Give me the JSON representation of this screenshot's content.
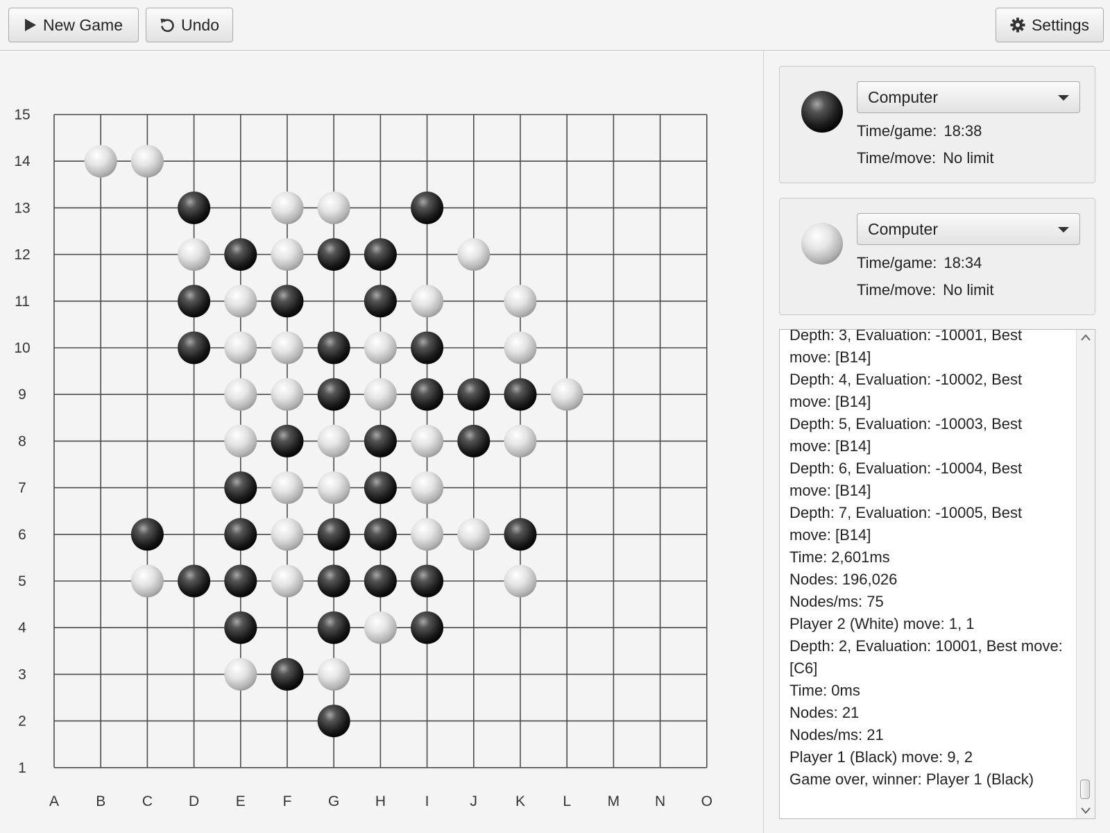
{
  "toolbar": {
    "new_game_label": "New Game",
    "undo_label": "Undo",
    "settings_label": "Settings"
  },
  "board": {
    "columns": [
      "A",
      "B",
      "C",
      "D",
      "E",
      "F",
      "G",
      "H",
      "I",
      "J",
      "K",
      "L",
      "M",
      "N",
      "O"
    ],
    "rows": [
      "15",
      "14",
      "13",
      "12",
      "11",
      "10",
      "9",
      "8",
      "7",
      "6",
      "5",
      "4",
      "3",
      "2",
      "1"
    ],
    "stones": [
      {
        "pos": "B14",
        "color": "white"
      },
      {
        "pos": "C14",
        "color": "white"
      },
      {
        "pos": "D13",
        "color": "black"
      },
      {
        "pos": "F13",
        "color": "white"
      },
      {
        "pos": "G13",
        "color": "white"
      },
      {
        "pos": "I13",
        "color": "black"
      },
      {
        "pos": "D12",
        "color": "white"
      },
      {
        "pos": "E12",
        "color": "black"
      },
      {
        "pos": "F12",
        "color": "white"
      },
      {
        "pos": "G12",
        "color": "black"
      },
      {
        "pos": "H12",
        "color": "black"
      },
      {
        "pos": "J12",
        "color": "white"
      },
      {
        "pos": "D11",
        "color": "black"
      },
      {
        "pos": "E11",
        "color": "white"
      },
      {
        "pos": "F11",
        "color": "black"
      },
      {
        "pos": "H11",
        "color": "black"
      },
      {
        "pos": "I11",
        "color": "white"
      },
      {
        "pos": "K11",
        "color": "white"
      },
      {
        "pos": "D10",
        "color": "black"
      },
      {
        "pos": "E10",
        "color": "white"
      },
      {
        "pos": "F10",
        "color": "white"
      },
      {
        "pos": "G10",
        "color": "black"
      },
      {
        "pos": "H10",
        "color": "white"
      },
      {
        "pos": "I10",
        "color": "black"
      },
      {
        "pos": "K10",
        "color": "white"
      },
      {
        "pos": "E9",
        "color": "white"
      },
      {
        "pos": "F9",
        "color": "white"
      },
      {
        "pos": "G9",
        "color": "black"
      },
      {
        "pos": "H9",
        "color": "white"
      },
      {
        "pos": "I9",
        "color": "black"
      },
      {
        "pos": "J9",
        "color": "black"
      },
      {
        "pos": "K9",
        "color": "black"
      },
      {
        "pos": "L9",
        "color": "white"
      },
      {
        "pos": "E8",
        "color": "white"
      },
      {
        "pos": "F8",
        "color": "black"
      },
      {
        "pos": "G8",
        "color": "white"
      },
      {
        "pos": "H8",
        "color": "black"
      },
      {
        "pos": "I8",
        "color": "white"
      },
      {
        "pos": "J8",
        "color": "black"
      },
      {
        "pos": "K8",
        "color": "white"
      },
      {
        "pos": "E7",
        "color": "black"
      },
      {
        "pos": "F7",
        "color": "white"
      },
      {
        "pos": "G7",
        "color": "white"
      },
      {
        "pos": "H7",
        "color": "black"
      },
      {
        "pos": "I7",
        "color": "white"
      },
      {
        "pos": "C6",
        "color": "black"
      },
      {
        "pos": "E6",
        "color": "black"
      },
      {
        "pos": "F6",
        "color": "white"
      },
      {
        "pos": "G6",
        "color": "black"
      },
      {
        "pos": "H6",
        "color": "black"
      },
      {
        "pos": "I6",
        "color": "white"
      },
      {
        "pos": "J6",
        "color": "white"
      },
      {
        "pos": "K6",
        "color": "black"
      },
      {
        "pos": "C5",
        "color": "white"
      },
      {
        "pos": "D5",
        "color": "black"
      },
      {
        "pos": "E5",
        "color": "black"
      },
      {
        "pos": "F5",
        "color": "white"
      },
      {
        "pos": "G5",
        "color": "black"
      },
      {
        "pos": "H5",
        "color": "black"
      },
      {
        "pos": "I5",
        "color": "black"
      },
      {
        "pos": "K5",
        "color": "white"
      },
      {
        "pos": "E4",
        "color": "black"
      },
      {
        "pos": "G4",
        "color": "black"
      },
      {
        "pos": "H4",
        "color": "white"
      },
      {
        "pos": "I4",
        "color": "black"
      },
      {
        "pos": "E3",
        "color": "white"
      },
      {
        "pos": "F3",
        "color": "black"
      },
      {
        "pos": "G3",
        "color": "white"
      },
      {
        "pos": "G2",
        "color": "black"
      }
    ]
  },
  "player1": {
    "stone": "black",
    "type": "Computer",
    "time_game_label": "Time/game:",
    "time_game_value": "18:38",
    "time_move_label": "Time/move:",
    "time_move_value": "No limit"
  },
  "player2": {
    "stone": "white",
    "type": "Computer",
    "time_game_label": "Time/game:",
    "time_game_value": "18:34",
    "time_move_label": "Time/move:",
    "time_move_value": "No limit"
  },
  "log": {
    "lines": [
      "Depth: 3, Evaluation: -10001, Best move: [B14]",
      "Depth: 4, Evaluation: -10002, Best move: [B14]",
      "Depth: 5, Evaluation: -10003, Best move: [B14]",
      "Depth: 6, Evaluation: -10004, Best move: [B14]",
      "Depth: 7, Evaluation: -10005, Best move: [B14]",
      "Time: 2,601ms",
      "Nodes: 196,026",
      "Nodes/ms: 75",
      "Player 2 (White) move: 1, 1",
      "Depth: 2, Evaluation: 10001, Best move: [C6]",
      "Time: 0ms",
      "Nodes: 21",
      "Nodes/ms: 21",
      "Player 1 (Black) move: 9, 2",
      "Game over, winner: Player 1 (Black)"
    ]
  },
  "colors": {
    "background": "#f4f4f4",
    "grid_line": "#4a4a4a",
    "black_stone": "#1f1f1f",
    "white_stone": "#d6d6d6"
  }
}
